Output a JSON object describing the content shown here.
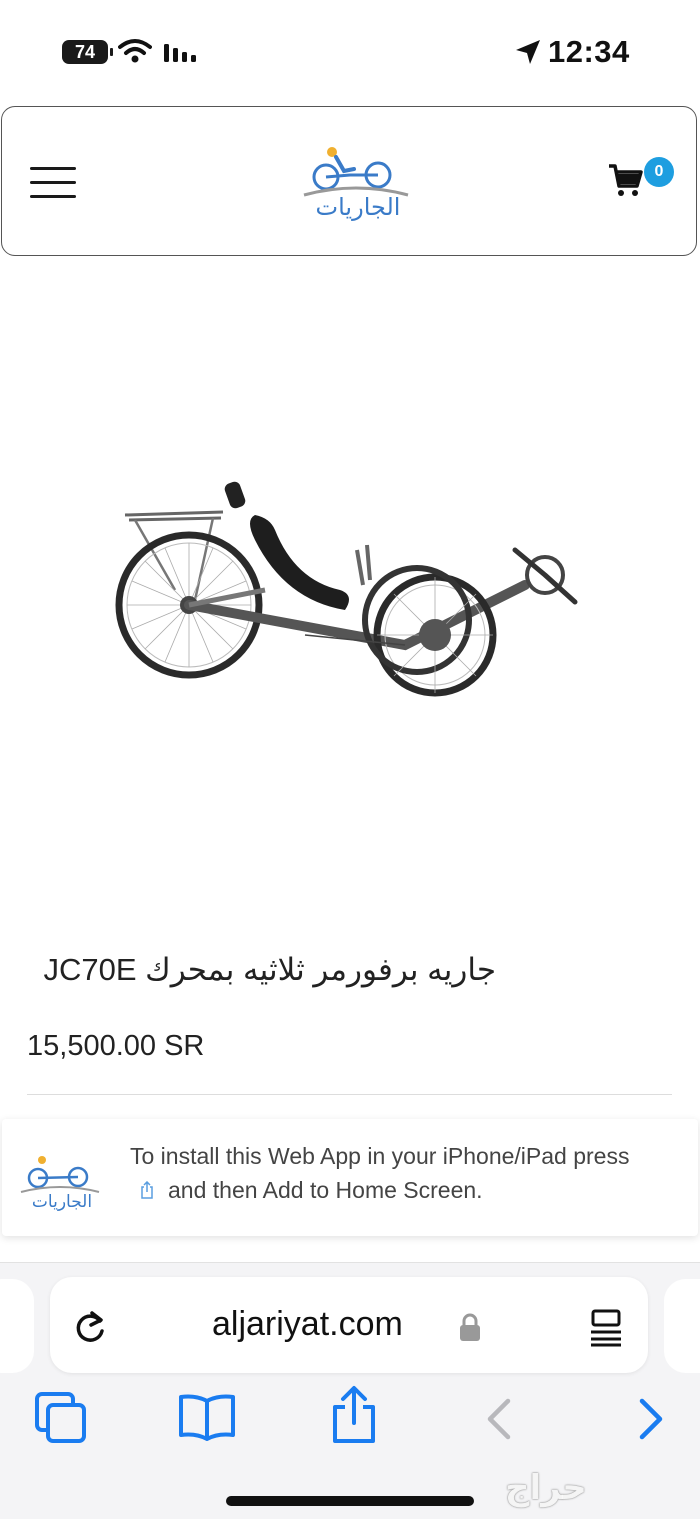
{
  "status_bar": {
    "battery": "74",
    "time": "12:34"
  },
  "header": {
    "logo_text": "الجاريات",
    "cart_count": "0"
  },
  "product": {
    "title": "جاريه برفورمر ثلاثيه بمحرك JC70E",
    "price": "15,500.00 SR"
  },
  "install_banner": {
    "line1": "To install this Web App in your iPhone/iPad press",
    "line2": "and then Add to Home Screen."
  },
  "browser": {
    "url": "aljariyat.com"
  },
  "watermark": "حراج",
  "colors": {
    "accent": "#1e9ee0",
    "ios_blue": "#1a7cf0",
    "logo_blue": "#3a7bc8"
  }
}
